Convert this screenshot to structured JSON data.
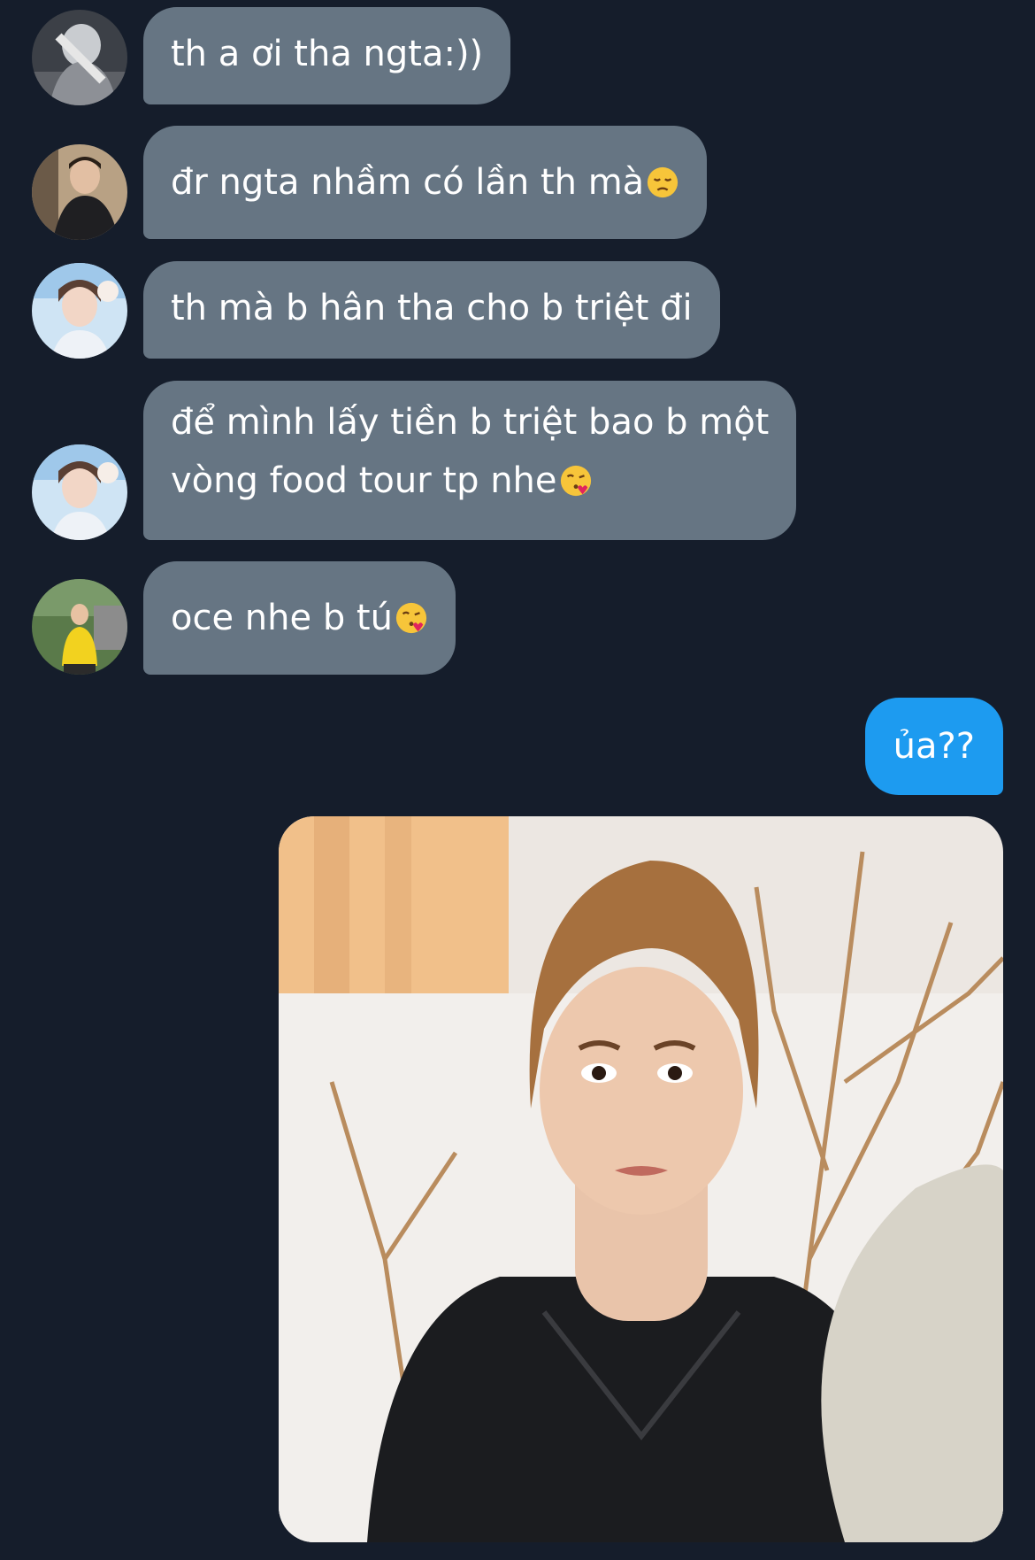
{
  "conversation": {
    "received": [
      {
        "text": "th a ơi tha ngta:))",
        "emoji": ""
      },
      {
        "text": "đr ngta nhầm có lần th mà",
        "emoji": "pensive-face"
      },
      {
        "text": "th mà b hân tha cho b triệt đi",
        "emoji": ""
      },
      {
        "line1": "để mình lấy tiền b triệt bao b một",
        "line2": "vòng food tour tp nhe",
        "emoji": "face-blowing-kiss"
      },
      {
        "text": "oce nhe b tú",
        "emoji": "face-blowing-kiss"
      }
    ],
    "sent": [
      {
        "text": "ủa??"
      }
    ],
    "sent_image": {
      "icon": "reaction-photo"
    }
  },
  "colors": {
    "background": "#151d2b",
    "received_bubble": "#667583",
    "sent_bubble": "#1d9bf0",
    "text": "#ffffff"
  }
}
